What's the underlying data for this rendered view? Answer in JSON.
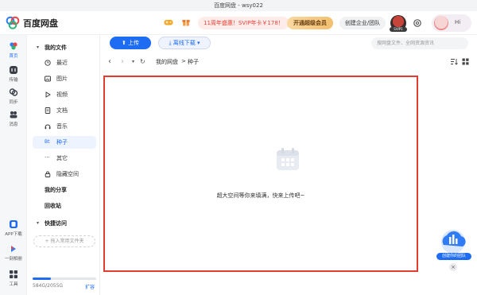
{
  "window": {
    "title": "百度网盘 - wsy022"
  },
  "header": {
    "brand": "百度网盘",
    "promo": "11周年盛惠！SVIP年卡￥178！",
    "vip_button": "开通超级会员",
    "team_button": "创建企业/团队",
    "avatar_badge": "SVIP1",
    "greeting": "Hi"
  },
  "rail": [
    {
      "label": "首页",
      "icon": "home-icon",
      "active": true
    },
    {
      "label": "传输",
      "icon": "transfer-icon"
    },
    {
      "label": "同步",
      "icon": "sync-icon"
    },
    {
      "label": "消息",
      "icon": "message-icon"
    },
    {
      "label": "APP下载",
      "icon": "app-download-icon"
    },
    {
      "label": "一刻相册",
      "icon": "album-icon"
    },
    {
      "label": "工具",
      "icon": "tools-icon"
    }
  ],
  "sidebar": {
    "my_files": "我的文件",
    "items": [
      {
        "label": "最近",
        "icon": "clock-icon"
      },
      {
        "label": "图片",
        "icon": "image-icon"
      },
      {
        "label": "视频",
        "icon": "video-icon"
      },
      {
        "label": "文档",
        "icon": "document-icon"
      },
      {
        "label": "音乐",
        "icon": "music-icon"
      },
      {
        "label": "种子",
        "icon": "bt-icon",
        "active": true
      },
      {
        "label": "其它",
        "icon": "more-icon"
      },
      {
        "label": "隐藏空间",
        "icon": "lock-icon"
      }
    ],
    "my_share": "我的分享",
    "recycle": "回收站",
    "quick_access": "快捷访问",
    "drag_hint": "+ 拖入常用文件夹",
    "storage": {
      "text": "584G/2055G",
      "used_fraction": 0.284
    },
    "expand": "扩容"
  },
  "toolbar": {
    "upload": "上传",
    "offline_download": "离线下载",
    "search_placeholder": "搜网盘文件、全网资源资讯"
  },
  "breadcrumb": {
    "root": "我的网盘",
    "sep": ">",
    "current": "种子"
  },
  "content": {
    "empty_text": "超大空间等你来填满，快来上传吧~"
  },
  "assistant": {
    "label": "创建你的团队"
  }
}
